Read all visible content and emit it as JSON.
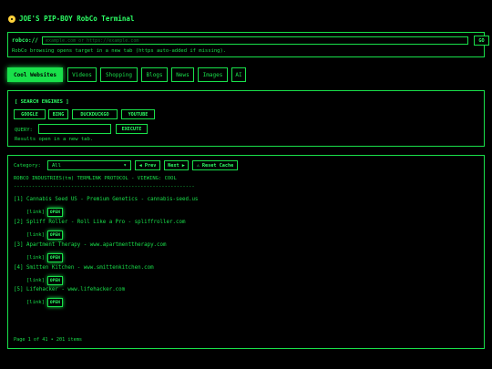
{
  "app": {
    "title": "JOE'S PIP-BOY RobCo Terminal",
    "icon": "radiation-icon"
  },
  "colors": {
    "accent": "#19e04a",
    "bright": "#2dff66",
    "background": "#000000",
    "warning": "#ffd23a"
  },
  "url_bar": {
    "label": "robco://",
    "placeholder": "example.com or https://example.com",
    "go_label": "GO",
    "help": "RobCo browsing opens target in a new tab (https auto-added if missing)."
  },
  "tabs": [
    {
      "label": "Cool Websites",
      "active": true
    },
    {
      "label": "Videos"
    },
    {
      "label": "Shopping"
    },
    {
      "label": "Blogs"
    },
    {
      "label": "News"
    },
    {
      "label": "Images"
    },
    {
      "label": "AI"
    }
  ],
  "search": {
    "header": "[ SEARCH ENGINES ]",
    "engines": [
      "GOOGLE",
      "BING",
      "DUCKDUCKGO",
      "YOUTUBE"
    ],
    "query_label": "QUERY:",
    "query_value": "",
    "execute_label": "EXECUTE",
    "note": "Results open in a new tab."
  },
  "results": {
    "category_label": "Category:",
    "category_value": "All",
    "prev_label": "◀ Prev",
    "next_label": "Next ▶",
    "reset_label": "⚠ Reset Cache",
    "protocol_line": "ROBCO INDUSTRIES(tm) TERMLINK PROTOCOL - VIEWING: COOL",
    "divider": "------------------------------------------------------------",
    "entries": [
      {
        "text": "[1] Cannabis Seed US - Premium Genetics - cannabis-seed.us"
      },
      {
        "text": "[2] Spliff Roller - Roll Like a Pro - spliffroller.com"
      },
      {
        "text": "[3] Apartment Therapy - www.apartmenttherapy.com"
      },
      {
        "text": "[4] Smitten Kitchen - www.smittenkitchen.com"
      },
      {
        "text": "[5] Lifehacker - www.lifehacker.com"
      }
    ],
    "link_label": "[link]",
    "open_label": "OPEN",
    "page_info": "Page 1 of 41 • 201 items"
  }
}
